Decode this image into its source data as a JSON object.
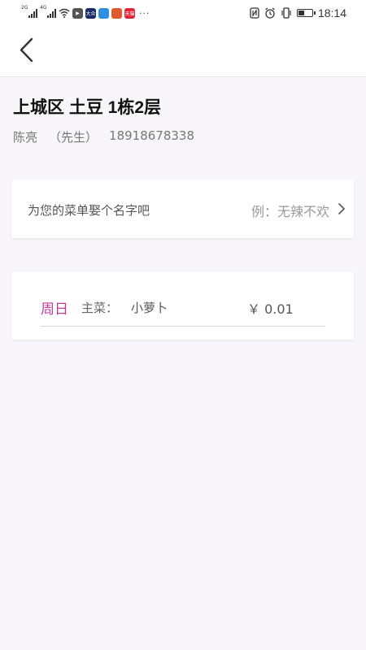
{
  "status_bar": {
    "network_1": "2G",
    "network_2": "4G",
    "time": "18:14",
    "battery_level": 0.45,
    "app_icons": [
      {
        "name": "video-app-icon",
        "color": "#555555",
        "label": "▶"
      },
      {
        "name": "dazhong-app-icon",
        "color": "#1b2a6b",
        "label": "大众"
      },
      {
        "name": "blue-app-icon",
        "color": "#2f8fe0",
        "label": ""
      },
      {
        "name": "colorful-app-icon",
        "color": "#e05a2f",
        "label": ""
      },
      {
        "name": "tmall-app-icon",
        "color": "#e0243a",
        "label": "天猫"
      }
    ],
    "more": "···"
  },
  "header": {
    "back_icon": "back-arrow-icon"
  },
  "address": {
    "title": "上城区 土豆 1栋2层",
    "name": "陈亮",
    "title_suffix": "（先生）",
    "phone": "18918678338"
  },
  "menu_name": {
    "label": "为您的菜单娶个名字吧",
    "hint": "例：无辣不欢",
    "icon": "chevron-right-icon"
  },
  "order": {
    "day": "周日",
    "type_label": "主菜：",
    "dish": "小萝卜",
    "price": "￥ 0.01"
  },
  "colors": {
    "accent": "#c0399c",
    "background": "#f8f6fa"
  }
}
